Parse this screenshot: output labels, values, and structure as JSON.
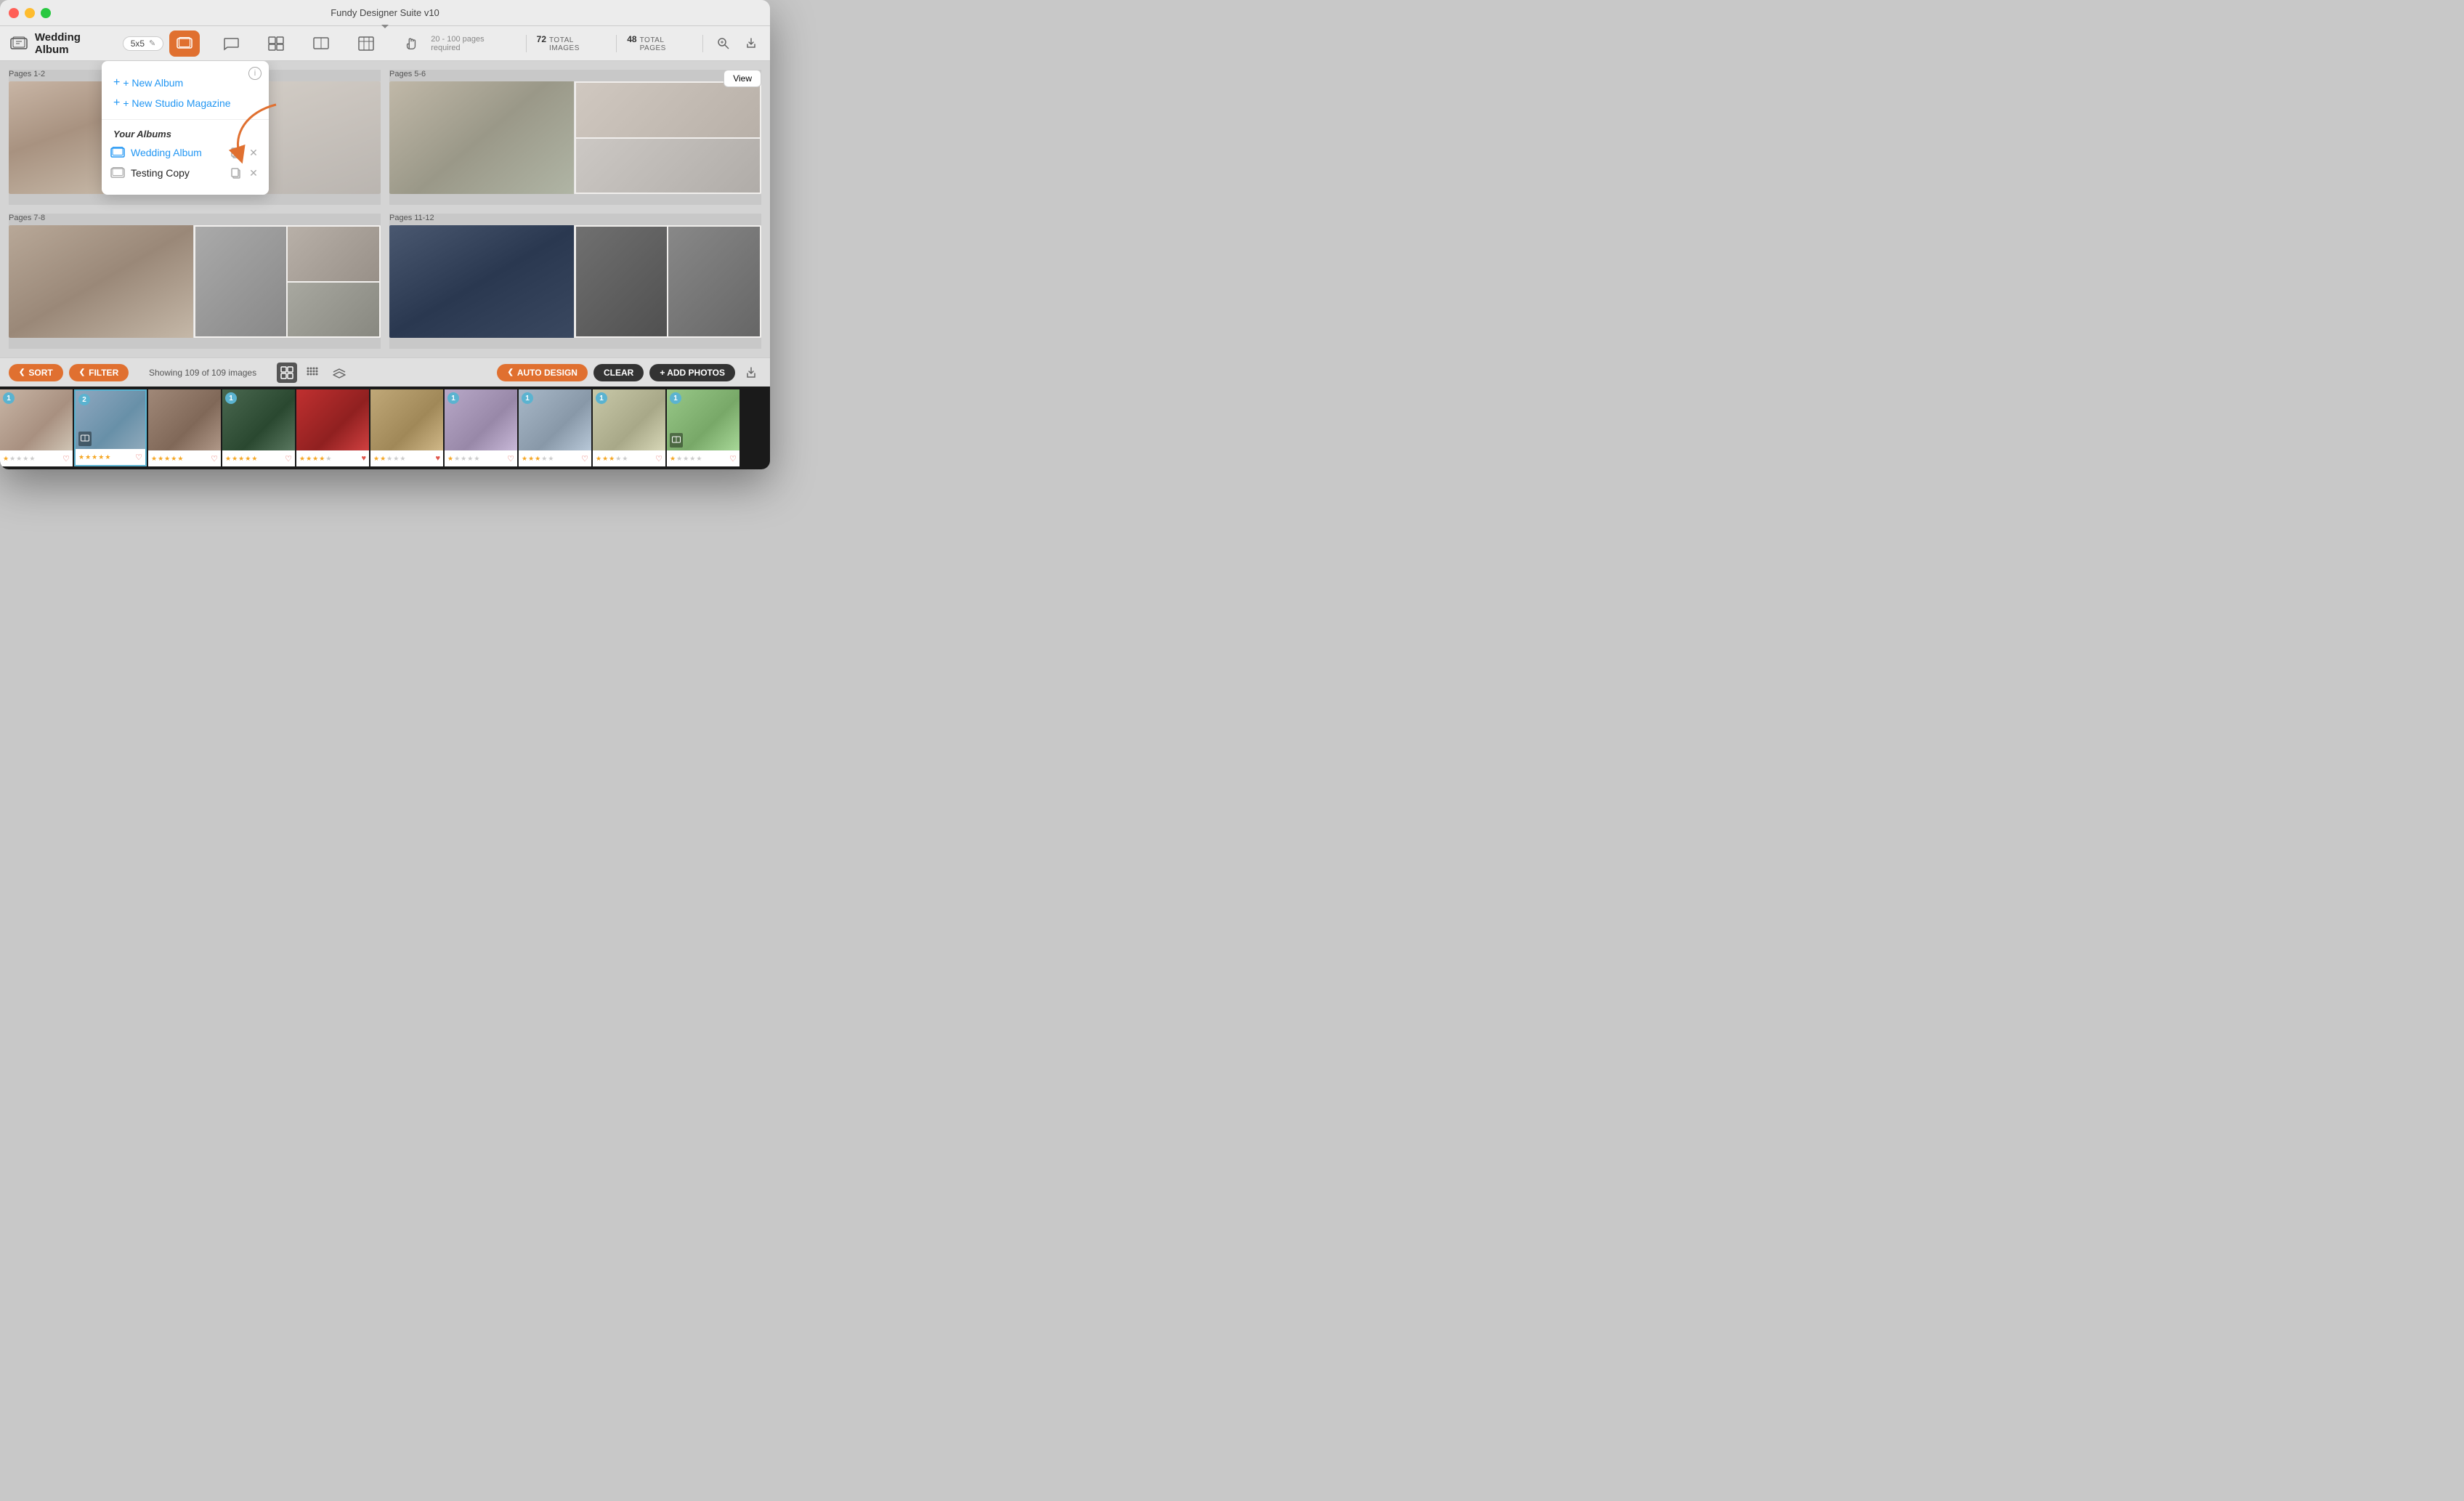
{
  "window": {
    "title": "Fundy Designer Suite v10"
  },
  "toolbar": {
    "album_name": "Wedding Album",
    "size_badge": "5x5",
    "edit_icon": "✎",
    "stats": {
      "pages_required": "20 - 100 pages required",
      "total_images": "72",
      "total_images_label": "TOTAL IMAGES",
      "total_pages": "48",
      "total_pages_label": "TOTAL PAGES"
    }
  },
  "dropdown": {
    "info_label": "i",
    "new_album_label": "+ New Album",
    "new_magazine_label": "+ New Studio Magazine",
    "section_label": "Your Albums",
    "albums": [
      {
        "name": "Wedding Album",
        "style": "blue",
        "id": "wedding-album"
      },
      {
        "name": "Testing Copy",
        "style": "black",
        "id": "testing-copy"
      }
    ],
    "copy_icon": "⧉",
    "close_icon": "✕"
  },
  "pages": [
    {
      "label": "Pages 1-2"
    },
    {
      "label": "Pages 5-6"
    },
    {
      "label": "Pages 7-8"
    },
    {
      "label": "Pages 11-12"
    }
  ],
  "view_button": "View",
  "bottom_toolbar": {
    "sort_label": "SORT",
    "filter_label": "FILTER",
    "showing_text": "Showing 109 of 109 images",
    "auto_design_label": "AUTO DESIGN",
    "clear_label": "CLEAR",
    "add_photos_label": "+ ADD PHOTOS"
  },
  "photo_strip": [
    {
      "id": "strip-1",
      "badge": "1",
      "stars": [
        1,
        0,
        0,
        0,
        0
      ],
      "hearted": false,
      "selected": false
    },
    {
      "id": "strip-2",
      "badge": "2",
      "stars": [
        1,
        1,
        1,
        1,
        1
      ],
      "hearted": false,
      "selected": true
    },
    {
      "id": "strip-3",
      "badge": null,
      "stars": [
        1,
        1,
        1,
        1,
        1
      ],
      "hearted": false,
      "selected": false
    },
    {
      "id": "strip-4",
      "badge": "1",
      "stars": [
        1,
        1,
        1,
        1,
        1
      ],
      "hearted": false,
      "selected": false
    },
    {
      "id": "strip-5",
      "badge": null,
      "stars": [
        1,
        1,
        1,
        1,
        0
      ],
      "hearted": true,
      "selected": false
    },
    {
      "id": "strip-6",
      "badge": null,
      "stars": [
        1,
        1,
        0,
        0,
        0
      ],
      "hearted": true,
      "selected": false
    },
    {
      "id": "strip-7",
      "badge": "1",
      "stars": [
        1,
        0,
        0,
        0,
        0
      ],
      "hearted": false,
      "selected": false
    },
    {
      "id": "strip-8",
      "badge": "1",
      "stars": [
        1,
        1,
        1,
        0,
        0
      ],
      "hearted": false,
      "selected": false
    },
    {
      "id": "strip-9",
      "badge": "1",
      "stars": [
        1,
        1,
        1,
        0,
        0
      ],
      "hearted": false,
      "selected": false
    },
    {
      "id": "strip-10",
      "badge": "1",
      "stars": [
        1,
        0,
        0,
        0,
        0
      ],
      "hearted": false,
      "selected": false
    }
  ]
}
